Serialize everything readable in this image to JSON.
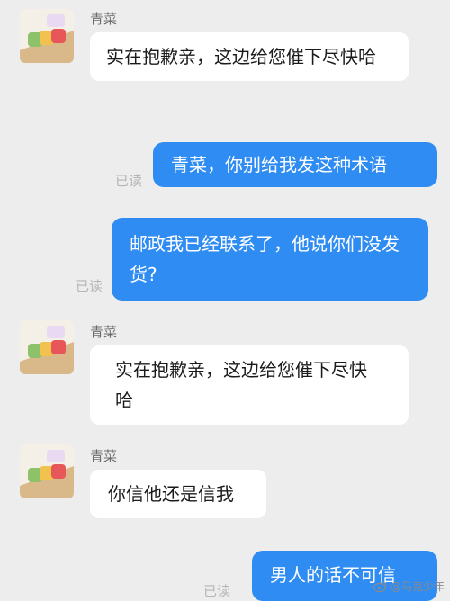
{
  "contact": {
    "name": "青菜"
  },
  "messages": [
    {
      "id": "m1",
      "text": "实在抱歉亲，这边给您催下尽快哈"
    },
    {
      "id": "m2",
      "text": "青菜，你别给我发这种术语",
      "status": "已读"
    },
    {
      "id": "m3",
      "text": "邮政我已经联系了，他说你们没发货?",
      "status": "已读"
    },
    {
      "id": "m4",
      "text": "实在抱歉亲，这边给您催下尽快哈"
    },
    {
      "id": "m5",
      "text": "你信他还是信我"
    },
    {
      "id": "m6",
      "text": "男人的话不可信",
      "status": "已读"
    }
  ],
  "watermark": {
    "text": "@马克少年"
  },
  "colors": {
    "outgoing_bubble": "#2f8cf2",
    "incoming_bubble": "#ffffff",
    "background": "#ededed"
  }
}
